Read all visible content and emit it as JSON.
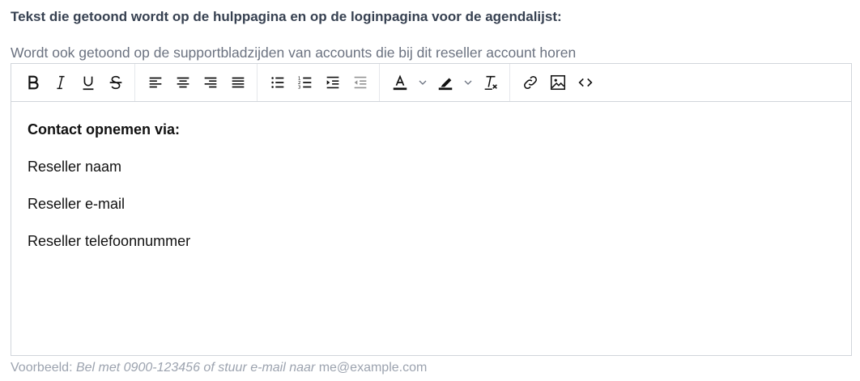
{
  "field": {
    "label": "Tekst die getoond wordt op de hulppagina en op de loginpagina voor de agendalijst:",
    "hint": "Wordt ook getoond op de supportbladzijden van accounts die bij dit reseller account horen"
  },
  "toolbar": {
    "groups": [
      [
        "bold-icon",
        "italic-icon",
        "underline-icon",
        "strikethrough-icon"
      ],
      [
        "align-left-icon",
        "align-center-icon",
        "align-right-icon",
        "align-justify-icon"
      ],
      [
        "bullet-list-icon",
        "numbered-list-icon",
        "indent-icon",
        "outdent-icon"
      ],
      [
        "text-color-icon",
        "highlight-color-icon",
        "clear-format-icon"
      ],
      [
        "link-icon",
        "image-icon",
        "code-icon"
      ]
    ]
  },
  "content": {
    "heading": "Contact opnemen via:",
    "lines": [
      "Reseller naam",
      "Reseller e-mail",
      "Reseller telefoonnummer"
    ]
  },
  "example": {
    "prefix": "Voorbeeld:",
    "text": "Bel met 0900-123456 of stuur e-mail naar",
    "email": "me@example.com"
  }
}
